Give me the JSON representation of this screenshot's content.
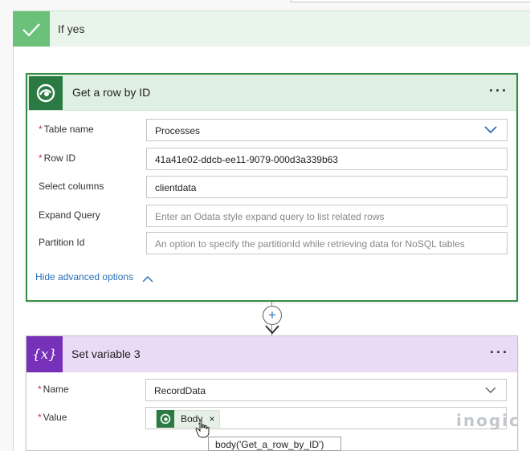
{
  "condition": {
    "branch_label": "If yes",
    "icon": "checkmark-icon",
    "color": "#6bc07a"
  },
  "get_row_action": {
    "title": "Get a row by ID",
    "icon": "dataverse-icon",
    "accent": "#358e47",
    "more_label": "···",
    "fields": {
      "table_name": {
        "label": "Table name",
        "required": "*",
        "value": "Processes"
      },
      "row_id": {
        "label": "Row ID",
        "required": "*",
        "value": "41a41e02-ddcb-ee11-9079-000d3a339b63"
      },
      "select_columns": {
        "label": "Select columns",
        "value": "clientdata"
      },
      "expand_query": {
        "label": "Expand Query",
        "placeholder": "Enter an Odata style expand query to list related rows"
      },
      "partition_id": {
        "label": "Partition Id",
        "placeholder": "An option to specify the partitionId while retrieving data for NoSQL tables"
      }
    },
    "advanced_link": "Hide advanced options"
  },
  "connector": {
    "add_symbol": "+"
  },
  "set_variable_action": {
    "title": "Set variable 3",
    "icon_text": "{x}",
    "accent": "#7730b8",
    "more_label": "···",
    "fields": {
      "name": {
        "label": "Name",
        "required": "*",
        "value": "RecordData"
      },
      "value": {
        "label": "Value",
        "required": "*",
        "token_label": "Body",
        "token_remove": "×"
      }
    }
  },
  "tooltip": {
    "text": "body('Get_a_row_by_ID')"
  },
  "watermark": {
    "text": "inogic"
  }
}
